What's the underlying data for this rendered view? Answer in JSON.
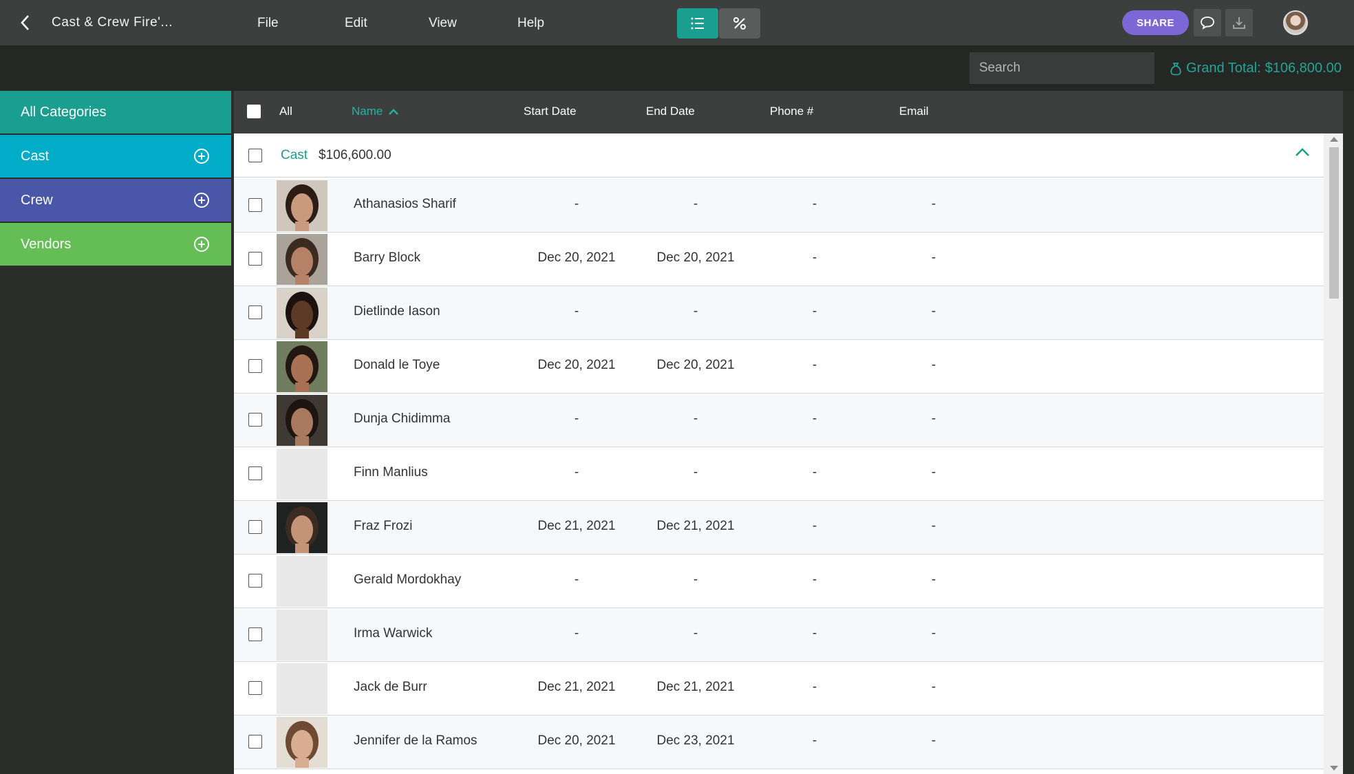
{
  "topbar": {
    "title": "Cast & Crew Fire'...",
    "menus": [
      "File",
      "Edit",
      "View",
      "Help"
    ],
    "share_label": "SHARE"
  },
  "subbar": {
    "search_placeholder": "Search",
    "grand_total_label": "Grand Total:",
    "grand_total_value": "$106,800.00"
  },
  "sidebar": {
    "items": [
      {
        "label": "All Categories",
        "color": "#1a9e8f"
      },
      {
        "label": "Cast",
        "color": "#00acc8"
      },
      {
        "label": "Crew",
        "color": "#4a56a8"
      },
      {
        "label": "Vendors",
        "color": "#64bd55"
      }
    ]
  },
  "table": {
    "columns": {
      "all": "All",
      "name": "Name",
      "start": "Start Date",
      "end": "End Date",
      "phone": "Phone #",
      "email": "Email"
    },
    "group": {
      "name": "Cast",
      "amount": "$106,600.00"
    },
    "rows": [
      {
        "name": "Athanasios Sharif",
        "start": "-",
        "end": "-",
        "phone": "-",
        "email": "-",
        "photo": "w1"
      },
      {
        "name": "Barry Block",
        "start": "Dec 20, 2021",
        "end": "Dec 20, 2021",
        "phone": "-",
        "email": "-",
        "photo": "m1"
      },
      {
        "name": "Dietlinde Iason",
        "start": "-",
        "end": "-",
        "phone": "-",
        "email": "-",
        "photo": "w2"
      },
      {
        "name": "Donald le Toye",
        "start": "Dec 20, 2021",
        "end": "Dec 20, 2021",
        "phone": "-",
        "email": "-",
        "photo": "m2"
      },
      {
        "name": "Dunja Chidimma",
        "start": "-",
        "end": "-",
        "phone": "-",
        "email": "-",
        "photo": "w3"
      },
      {
        "name": "Finn Manlius",
        "start": "-",
        "end": "-",
        "phone": "-",
        "email": "-",
        "photo": ""
      },
      {
        "name": "Fraz Frozi",
        "start": "Dec 21, 2021",
        "end": "Dec 21, 2021",
        "phone": "-",
        "email": "-",
        "photo": "m3"
      },
      {
        "name": "Gerald Mordokhay",
        "start": "-",
        "end": "-",
        "phone": "-",
        "email": "-",
        "photo": ""
      },
      {
        "name": "Irma Warwick",
        "start": "-",
        "end": "-",
        "phone": "-",
        "email": "-",
        "photo": ""
      },
      {
        "name": "Jack de Burr",
        "start": "Dec 21, 2021",
        "end": "Dec 21, 2021",
        "phone": "-",
        "email": "-",
        "photo": ""
      },
      {
        "name": "Jennifer de la Ramos",
        "start": "Dec 20, 2021",
        "end": "Dec 23, 2021",
        "phone": "-",
        "email": "-",
        "photo": "w4"
      }
    ]
  }
}
